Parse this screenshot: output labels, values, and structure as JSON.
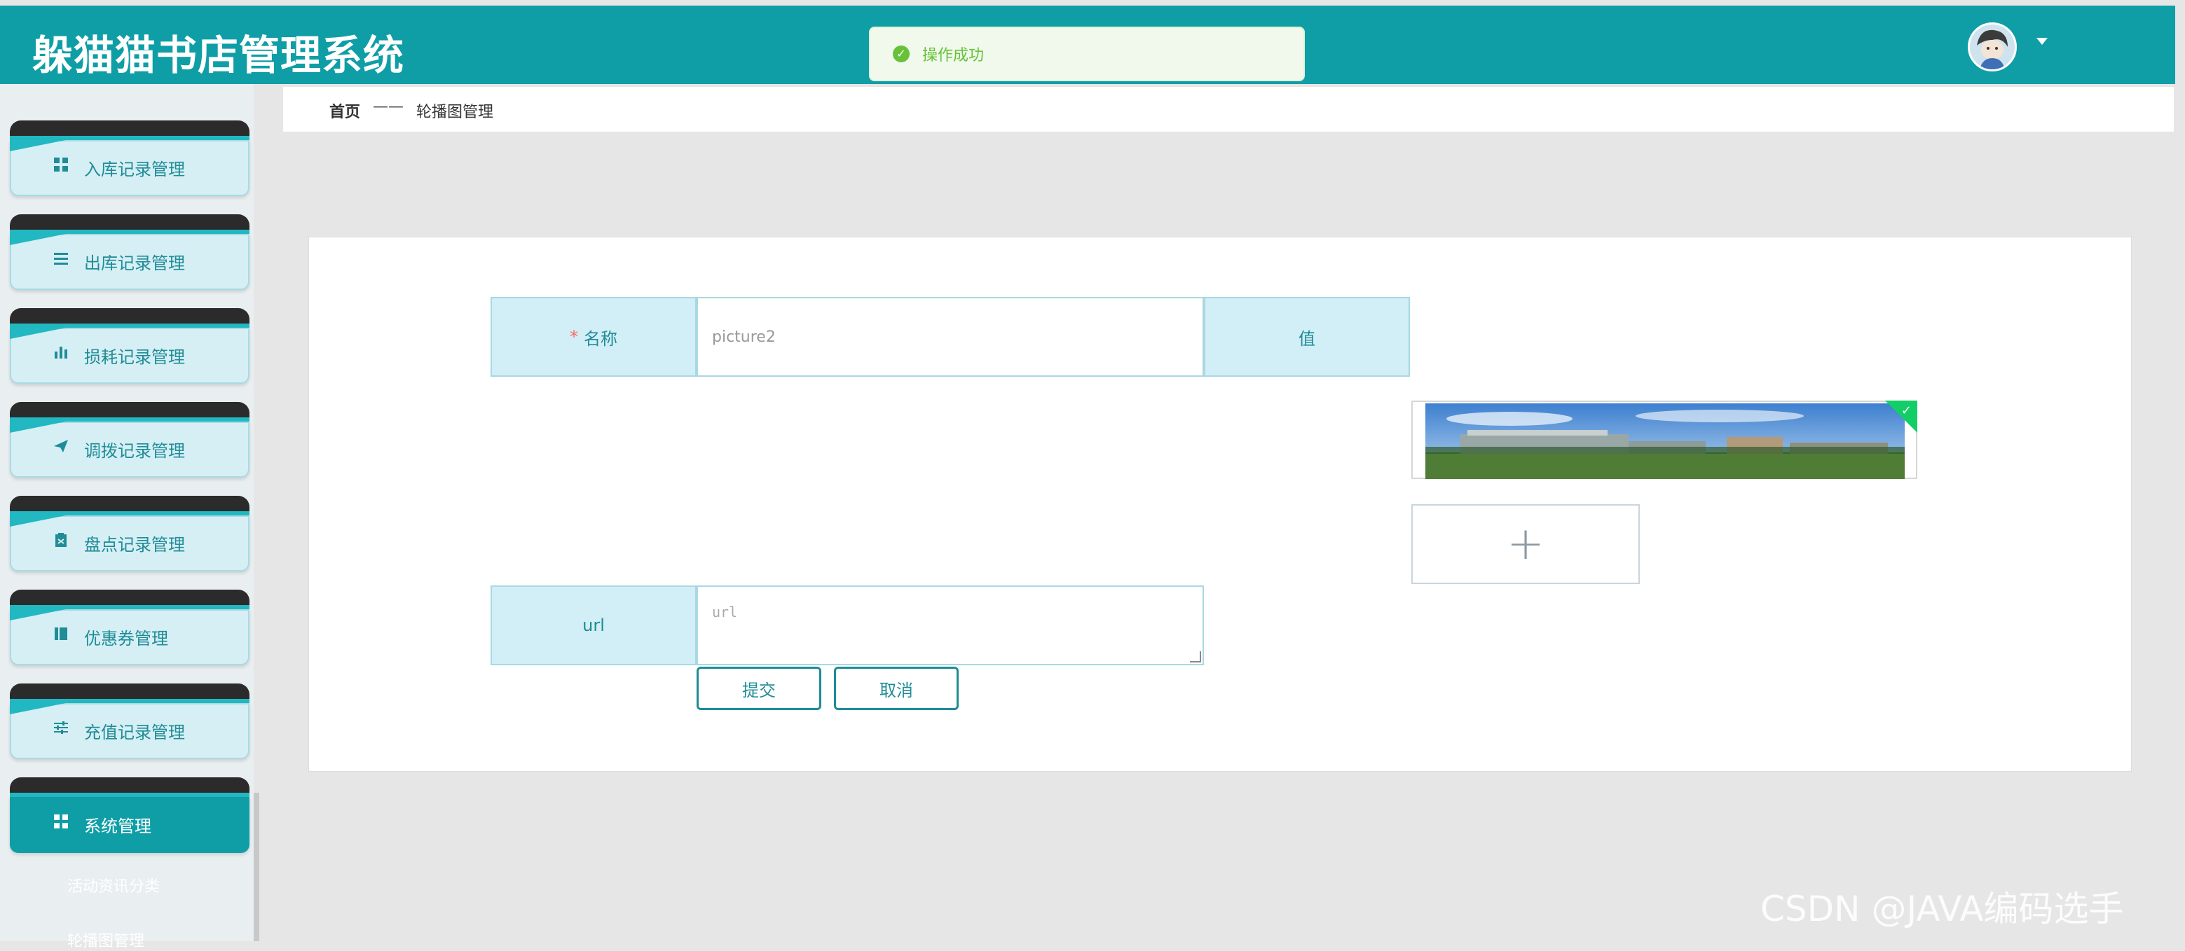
{
  "header": {
    "app_title": "躲猫猫书店管理系统",
    "toast_message": "操作成功"
  },
  "sidebar": {
    "items": [
      {
        "label": "入库记录管理",
        "icon": "grid-icon"
      },
      {
        "label": "出库记录管理",
        "icon": "list-icon"
      },
      {
        "label": "损耗记录管理",
        "icon": "bar-chart-icon"
      },
      {
        "label": "调拨记录管理",
        "icon": "send-icon"
      },
      {
        "label": "盘点记录管理",
        "icon": "clipboard-icon"
      },
      {
        "label": "优惠券管理",
        "icon": "book-icon"
      },
      {
        "label": "充值记录管理",
        "icon": "sliders-icon"
      },
      {
        "label": "系统管理",
        "icon": "grid-icon",
        "active": true
      }
    ],
    "submenu": [
      "活动资讯分类",
      "轮播图管理"
    ]
  },
  "breadcrumb": {
    "home": "首页",
    "separator": "——",
    "current": "轮播图管理"
  },
  "form": {
    "name_label": "名称",
    "required_mark": "*",
    "name_value": "picture2",
    "value_label": "值",
    "url_label": "url",
    "url_placeholder": "url",
    "add_symbol": "+",
    "submit_label": "提交",
    "cancel_label": "取消"
  },
  "watermark": "CSDN @JAVA编码选手",
  "colors": {
    "primary": "#0f9ea6",
    "label_bg": "#d2eef6",
    "success": "#67c23a"
  }
}
